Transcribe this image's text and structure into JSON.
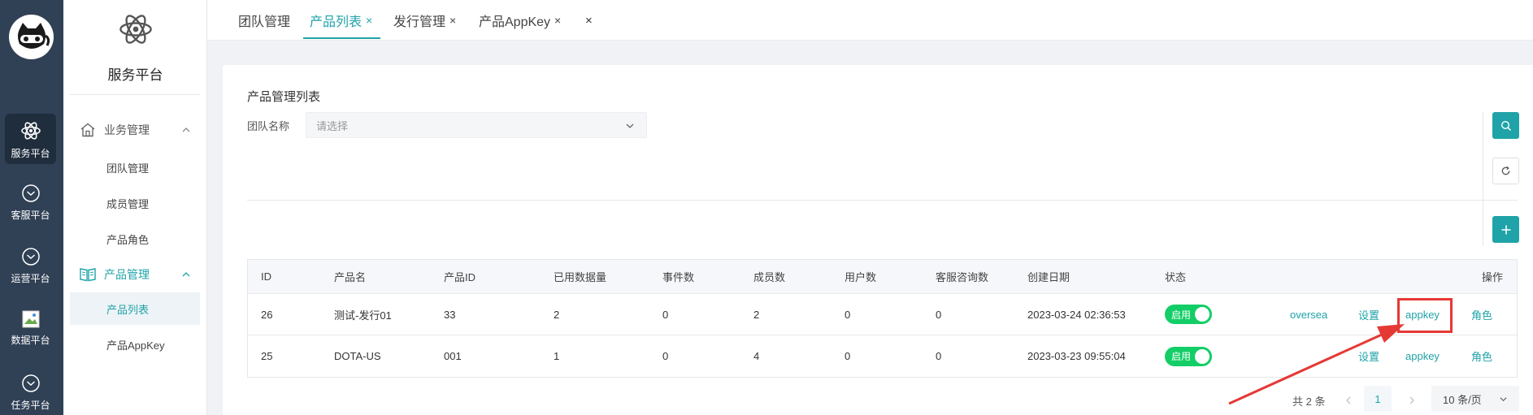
{
  "rail": {
    "items": [
      {
        "label": "服务平台",
        "icon": "atom-icon"
      },
      {
        "label": "客服平台",
        "icon": "chevron-circle-icon"
      },
      {
        "label": "运营平台",
        "icon": "chevron-circle-icon"
      },
      {
        "label": "数据平台",
        "icon": "broken-image-icon"
      },
      {
        "label": "任务平台",
        "icon": "chevron-circle-icon"
      }
    ]
  },
  "subnav": {
    "title": "服务平台",
    "groups": [
      {
        "label": "业务管理",
        "icon": "home-icon",
        "items": [
          "团队管理",
          "成员管理",
          "产品角色"
        ]
      },
      {
        "label": "产品管理",
        "icon": "book-icon",
        "items": [
          "产品列表",
          "产品AppKey"
        ]
      }
    ]
  },
  "tabs": [
    {
      "label": "团队管理",
      "close": ""
    },
    {
      "label": "产品列表",
      "close": "×"
    },
    {
      "label": "发行管理",
      "close": "×"
    },
    {
      "label": "产品AppKey",
      "close": "×"
    }
  ],
  "tab_close_all": "×",
  "page": {
    "title": "产品管理列表",
    "filter_label": "团队名称",
    "filter_placeholder": "请选择"
  },
  "table": {
    "headers": [
      "ID",
      "产品名",
      "产品ID",
      "已用数据量",
      "事件数",
      "成员数",
      "用户数",
      "客服咨询数",
      "创建日期",
      "状态",
      "操作"
    ],
    "rows": [
      {
        "id": "26",
        "name": "测试-发行01",
        "pid": "33",
        "used": "2",
        "events": "0",
        "members": "2",
        "users": "0",
        "consults": "0",
        "created": "2023-03-24 02:36:53",
        "status": "启用",
        "actions": [
          "oversea",
          "设置",
          "appkey",
          "角色"
        ]
      },
      {
        "id": "25",
        "name": "DOTA-US",
        "pid": "001",
        "used": "1",
        "events": "0",
        "members": "4",
        "users": "0",
        "consults": "0",
        "created": "2023-03-23 09:55:04",
        "status": "启用",
        "actions": [
          "设置",
          "appkey",
          "角色"
        ]
      }
    ]
  },
  "pagination": {
    "total": "共 2 条",
    "current": "1",
    "page_size": "10 条/页"
  },
  "colors": {
    "accent": "#20a3a8",
    "rail_bg": "#304156",
    "toggle_on": "#13ce66",
    "highlight": "#e53935"
  }
}
